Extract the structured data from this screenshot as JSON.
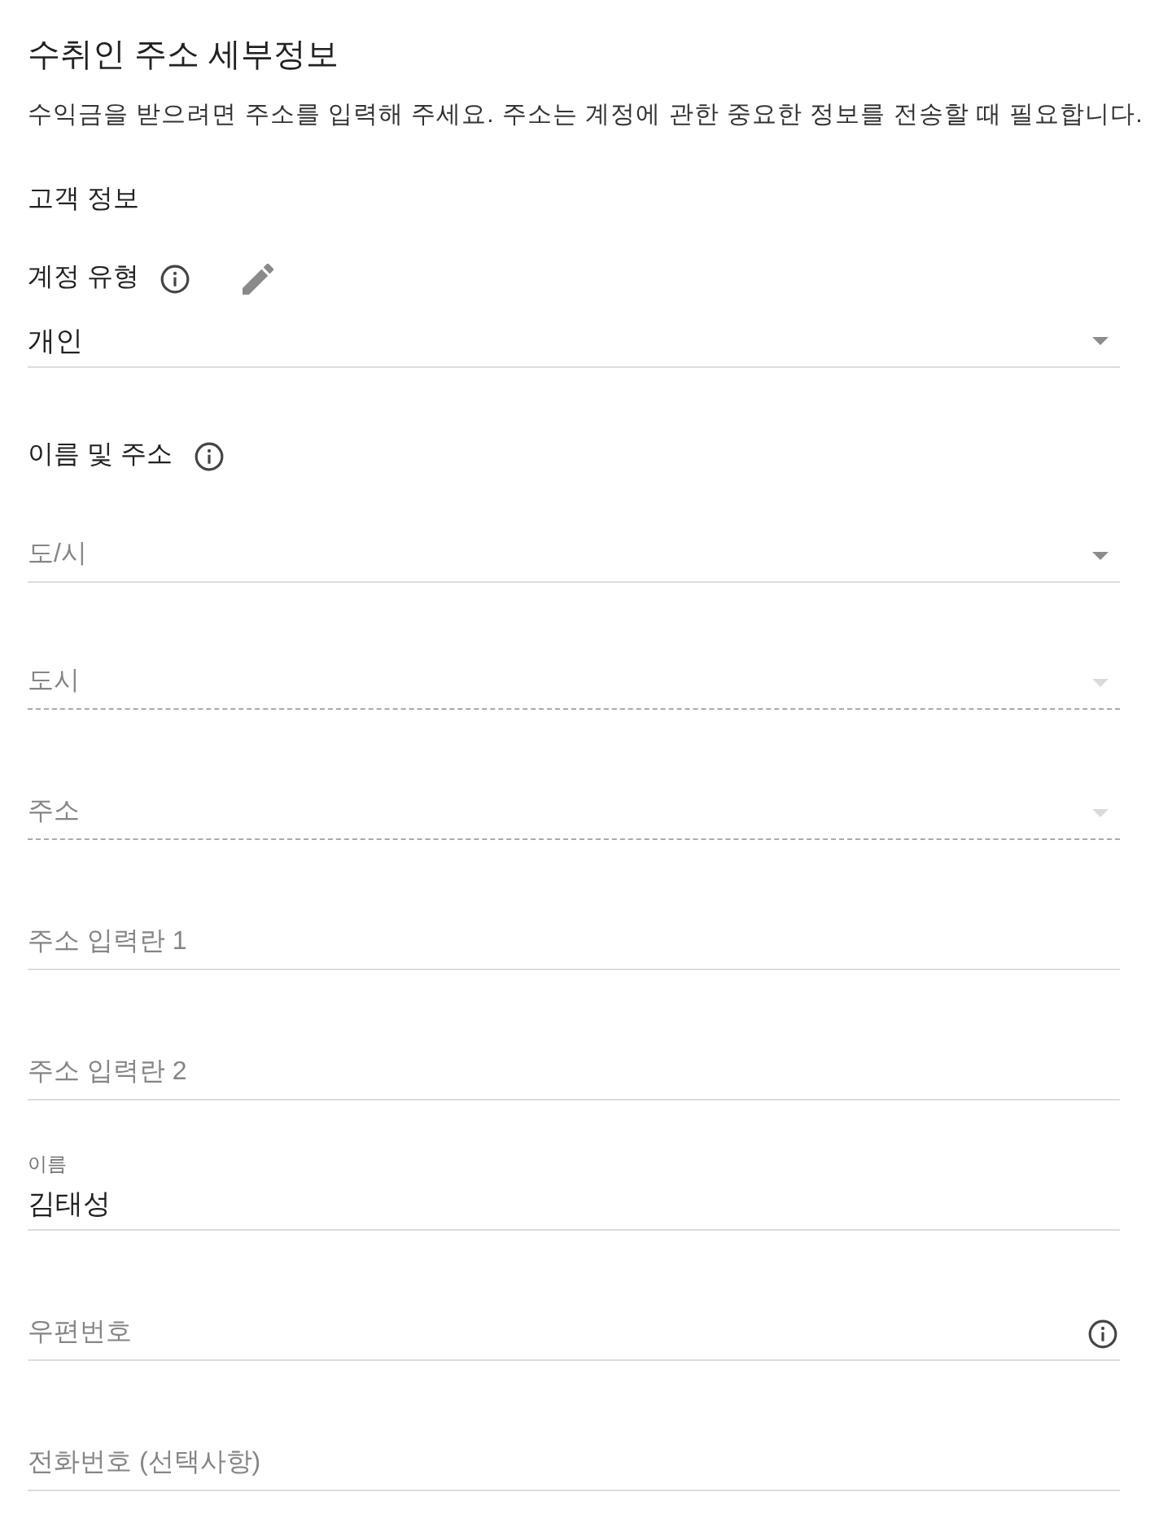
{
  "page": {
    "title": "수취인 주소 세부정보",
    "description": "수익금을 받으려면 주소를 입력해 주세요. 주소는 계정에 관한 중요한 정보를 전송할 때 필요합니다."
  },
  "section": {
    "title": "고객 정보"
  },
  "account_type": {
    "label": "계정 유형",
    "kind": "dropdown",
    "value": "개인",
    "disabled": false
  },
  "name_and_address": {
    "label": "이름 및 주소",
    "fields": [
      {
        "kind": "dropdown",
        "placeholder": "도/시",
        "disabled": false,
        "info_icon": false
      },
      {
        "kind": "dropdown",
        "placeholder": "도시",
        "disabled": true,
        "info_icon": false
      },
      {
        "kind": "dropdown",
        "placeholder": "주소",
        "disabled": true,
        "info_icon": false
      },
      {
        "kind": "text",
        "placeholder": "주소 입력란 1",
        "disabled": false,
        "info_icon": false
      },
      {
        "kind": "text",
        "placeholder": "주소 입력란 2",
        "disabled": false,
        "info_icon": false
      },
      {
        "kind": "text",
        "label": "이름",
        "value": "김태성",
        "disabled": false,
        "info_icon": false
      },
      {
        "kind": "text",
        "placeholder": "우편번호",
        "disabled": false,
        "info_icon": true
      },
      {
        "kind": "text",
        "placeholder": "전화번호 (선택사항)",
        "disabled": false,
        "info_icon": false
      }
    ]
  }
}
